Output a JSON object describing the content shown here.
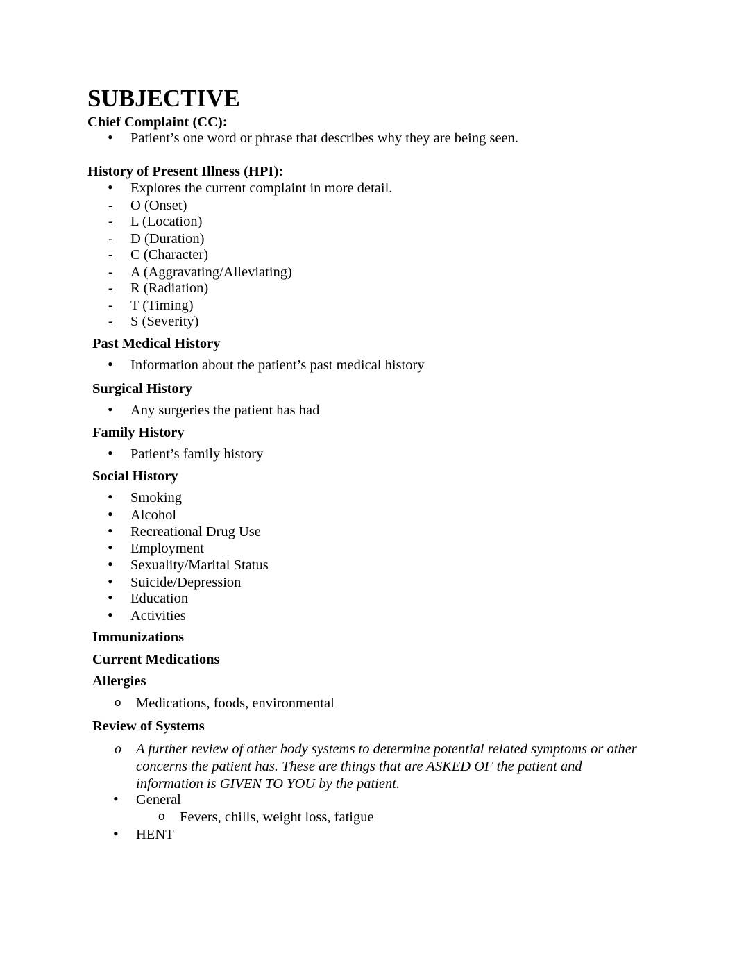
{
  "document": {
    "title": "SUBJECTIVE",
    "sections": [
      {
        "heading": "Chief Complaint (CC):",
        "items": [
          "Patient’s one word or phrase that describes why they are being seen."
        ]
      },
      {
        "heading": "History of Present Illness (HPI):",
        "items": [
          "Explores the current complaint in more detail."
        ],
        "mnemonic": [
          "O (Onset)",
          "L (Location)",
          "D (Duration)",
          "C (Character)",
          "A (Aggravating/Alleviating)",
          "R (Radiation)",
          "T (Timing)",
          "S (Severity)"
        ]
      },
      {
        "heading": "Past Medical History",
        "items": [
          "Information about the patient’s past medical history"
        ]
      },
      {
        "heading": "Surgical History",
        "items": [
          "Any surgeries the patient has had"
        ]
      },
      {
        "heading": "Family History",
        "items": [
          "Patient’s family history"
        ]
      },
      {
        "heading": "Social History",
        "items": [
          "Smoking",
          "Alcohol",
          "Recreational Drug Use",
          "Employment",
          "Sexuality/Marital Status",
          "Suicide/Depression",
          "Education",
          "Activities"
        ]
      },
      {
        "heading": "Immunizations"
      },
      {
        "heading": "Current Medications"
      },
      {
        "heading": "Allergies",
        "items": [
          "Medications, foods, environmental"
        ]
      },
      {
        "heading": "Review of Systems",
        "description": [
          "A further review of other body systems to determine potential related symptoms or other",
          "concerns the patient has.  These are things that are ASKED OF the patient and",
          "information is GIVEN TO YOU by the patient."
        ],
        "systems": [
          {
            "name": "General",
            "details": [
              "Fevers, chills, weight loss, fatigue"
            ]
          },
          {
            "name": "HENT"
          }
        ]
      }
    ]
  },
  "markers": {
    "bullet": "•",
    "dash": "-",
    "circle": "o"
  }
}
